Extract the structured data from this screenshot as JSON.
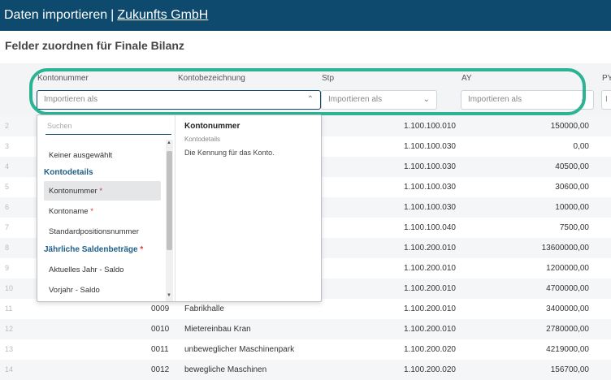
{
  "header": {
    "title_prefix": "Daten importieren",
    "separator": "|",
    "company": "Zukunfts GmbH"
  },
  "subtitle": "Felder zuordnen für Finale Bilanz",
  "columns": [
    {
      "label": "Kontonummer",
      "select_placeholder": "Importieren als",
      "chevron": "⌃"
    },
    {
      "label": "Kontobezeichnung"
    },
    {
      "label": "Stp",
      "select_placeholder": "Importieren als",
      "chevron": "⌄"
    },
    {
      "label": "AY",
      "select_placeholder": "Importieren als",
      "chevron": "⌄"
    },
    {
      "label": "PY",
      "select_placeholder": "I"
    }
  ],
  "rows": [
    {
      "idx": "2",
      "num": "",
      "name": "",
      "stp": "1.100.100.010",
      "ay": "150000,00"
    },
    {
      "idx": "3",
      "num": "",
      "name": "",
      "stp": "1.100.100.030",
      "ay": "0,00"
    },
    {
      "idx": "4",
      "num": "",
      "name": "",
      "stp": "1.100.100.030",
      "ay": "40500,00"
    },
    {
      "idx": "5",
      "num": "",
      "name": "",
      "stp": "1.100.100.030",
      "ay": "30600,00"
    },
    {
      "idx": "6",
      "num": "",
      "name": "",
      "stp": "1.100.100.030",
      "ay": "10000,00"
    },
    {
      "idx": "7",
      "num": "",
      "name": "",
      "stp": "1.100.100.040",
      "ay": "7500,00"
    },
    {
      "idx": "8",
      "num": "",
      "name": "",
      "stp": "1.100.200.010",
      "ay": "13600000,00"
    },
    {
      "idx": "9",
      "num": "",
      "name": "",
      "stp": "1.100.200.010",
      "ay": "1200000,00"
    },
    {
      "idx": "10",
      "num": "",
      "name": "",
      "stp": "1.100.200.010",
      "ay": "4700000,00"
    },
    {
      "idx": "11",
      "num": "0009",
      "name": "Fabrikhalle",
      "stp": "1.100.200.010",
      "ay": "3400000,00"
    },
    {
      "idx": "12",
      "num": "0010",
      "name": "Mietereinbau Kran",
      "stp": "1.100.200.010",
      "ay": "2780000,00"
    },
    {
      "idx": "13",
      "num": "0011",
      "name": "unbeweglicher Maschinenpark",
      "stp": "1.100.200.020",
      "ay": "4219000,00"
    },
    {
      "idx": "14",
      "num": "0012",
      "name": "bewegliche Maschinen",
      "stp": "1.100.200.020",
      "ay": "156700,00"
    }
  ],
  "dropdown": {
    "search_placeholder": "Suchen",
    "none_item": "Keiner ausgewählt",
    "groups": [
      {
        "label": "Kontodetails",
        "required": "",
        "items": [
          {
            "label": "Kontonummer",
            "required": "*"
          },
          {
            "label": "Kontoname",
            "required": "*"
          },
          {
            "label": "Standardpositionsnummer",
            "required": ""
          }
        ]
      },
      {
        "label": "Jährliche Saldenbeträge",
        "required": "*",
        "items": [
          {
            "label": "Aktuelles Jahr - Saldo",
            "required": ""
          },
          {
            "label": "Vorjahr - Saldo",
            "required": ""
          }
        ]
      }
    ],
    "detail": {
      "title": "Kontonummer",
      "group": "Kontodetails",
      "description": "Die Kennung für das Konto."
    }
  },
  "colors": {
    "header_bg": "#0d4a6e",
    "highlight": "#2bb394",
    "group_text": "#1d5f86",
    "required": "#d33333"
  }
}
